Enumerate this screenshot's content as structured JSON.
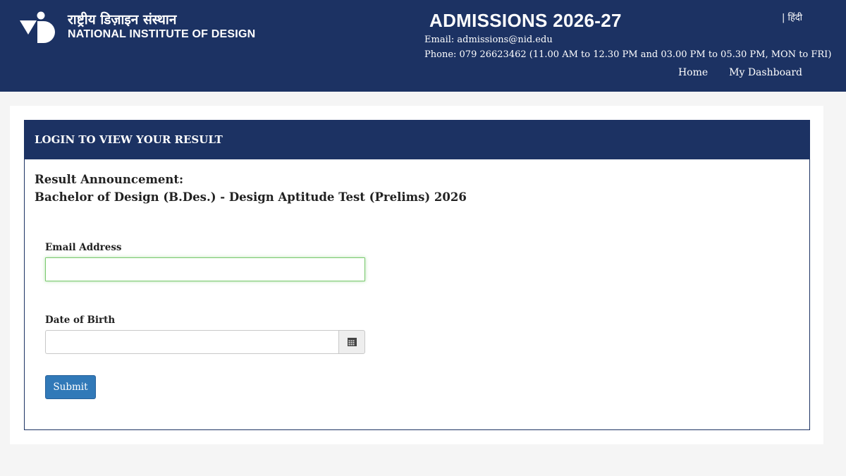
{
  "header": {
    "logo_hindi": "राष्ट्रीय डिज़ाइन संस्थान",
    "logo_english": "NATIONAL INSTITUTE OF DESIGN",
    "title": "ADMISSIONS 2026-27",
    "email_line": "Email: admissions@nid.edu",
    "phone_line": "Phone: 079 26623462 (11.00 AM to 12.30 PM and 03.00 PM to 05.30 PM, MON to FRI)",
    "language_link": "| हिंदी",
    "nav": {
      "home": "Home",
      "dashboard": "My Dashboard"
    },
    "logo_icon": "nid-logo",
    "colors": {
      "header_bg": "#1c3263"
    }
  },
  "panel": {
    "heading": "LOGIN TO VIEW YOUR RESULT",
    "announcement_line1": "Result Announcement:",
    "announcement_line2": "Bachelor of Design (B.Des.) - Design Aptitude Test (Prelims) 2026"
  },
  "form": {
    "email_label": "Email Address",
    "email_value": "",
    "dob_label": "Date of Birth",
    "dob_value": "",
    "calendar_icon": "calendar-icon",
    "submit_label": "Submit",
    "colors": {
      "submit_bg": "#3179b8",
      "focus_border": "#7ac86e"
    }
  }
}
